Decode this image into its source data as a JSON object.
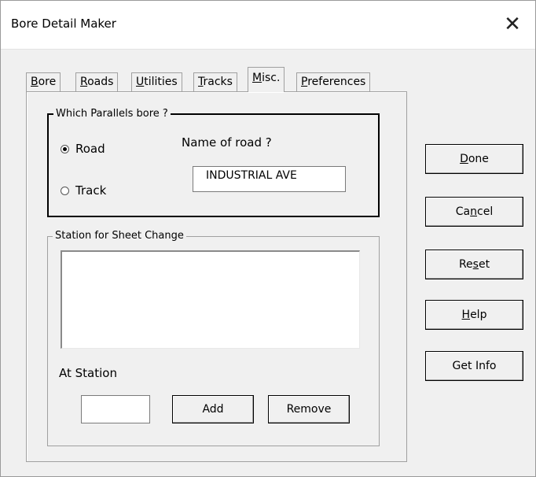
{
  "window": {
    "title": "Bore Detail Maker",
    "close_glyph": "✕"
  },
  "tabs": [
    {
      "pre": "",
      "key": "B",
      "post": "ore"
    },
    {
      "pre": "",
      "key": "R",
      "post": "oads"
    },
    {
      "pre": "",
      "key": "U",
      "post": "tilities"
    },
    {
      "pre": "",
      "key": "T",
      "post": "racks"
    },
    {
      "pre": "",
      "key": "M",
      "post": "isc."
    },
    {
      "pre": "",
      "key": "P",
      "post": "references"
    }
  ],
  "active_tab": "Misc.",
  "parallel_group": {
    "legend": "Which Parallels bore ?",
    "options": [
      {
        "label": "Road",
        "selected": true
      },
      {
        "label": "Track",
        "selected": false
      }
    ],
    "road_name_label": "Name of road ?",
    "road_name_value": "INDUSTRIAL AVE"
  },
  "station_group": {
    "legend": "Station for Sheet Change",
    "at_station_label": "At Station",
    "at_station_value": "",
    "add_label": "Add",
    "remove_label": "Remove"
  },
  "buttons": {
    "done": {
      "pre": "",
      "key": "D",
      "post": "one"
    },
    "cancel": {
      "pre": "Ca",
      "key": "n",
      "post": "cel"
    },
    "reset": {
      "pre": "Re",
      "key": "s",
      "post": "et"
    },
    "help": {
      "pre": "",
      "key": "H",
      "post": "elp"
    },
    "get_info": "Get Info"
  }
}
